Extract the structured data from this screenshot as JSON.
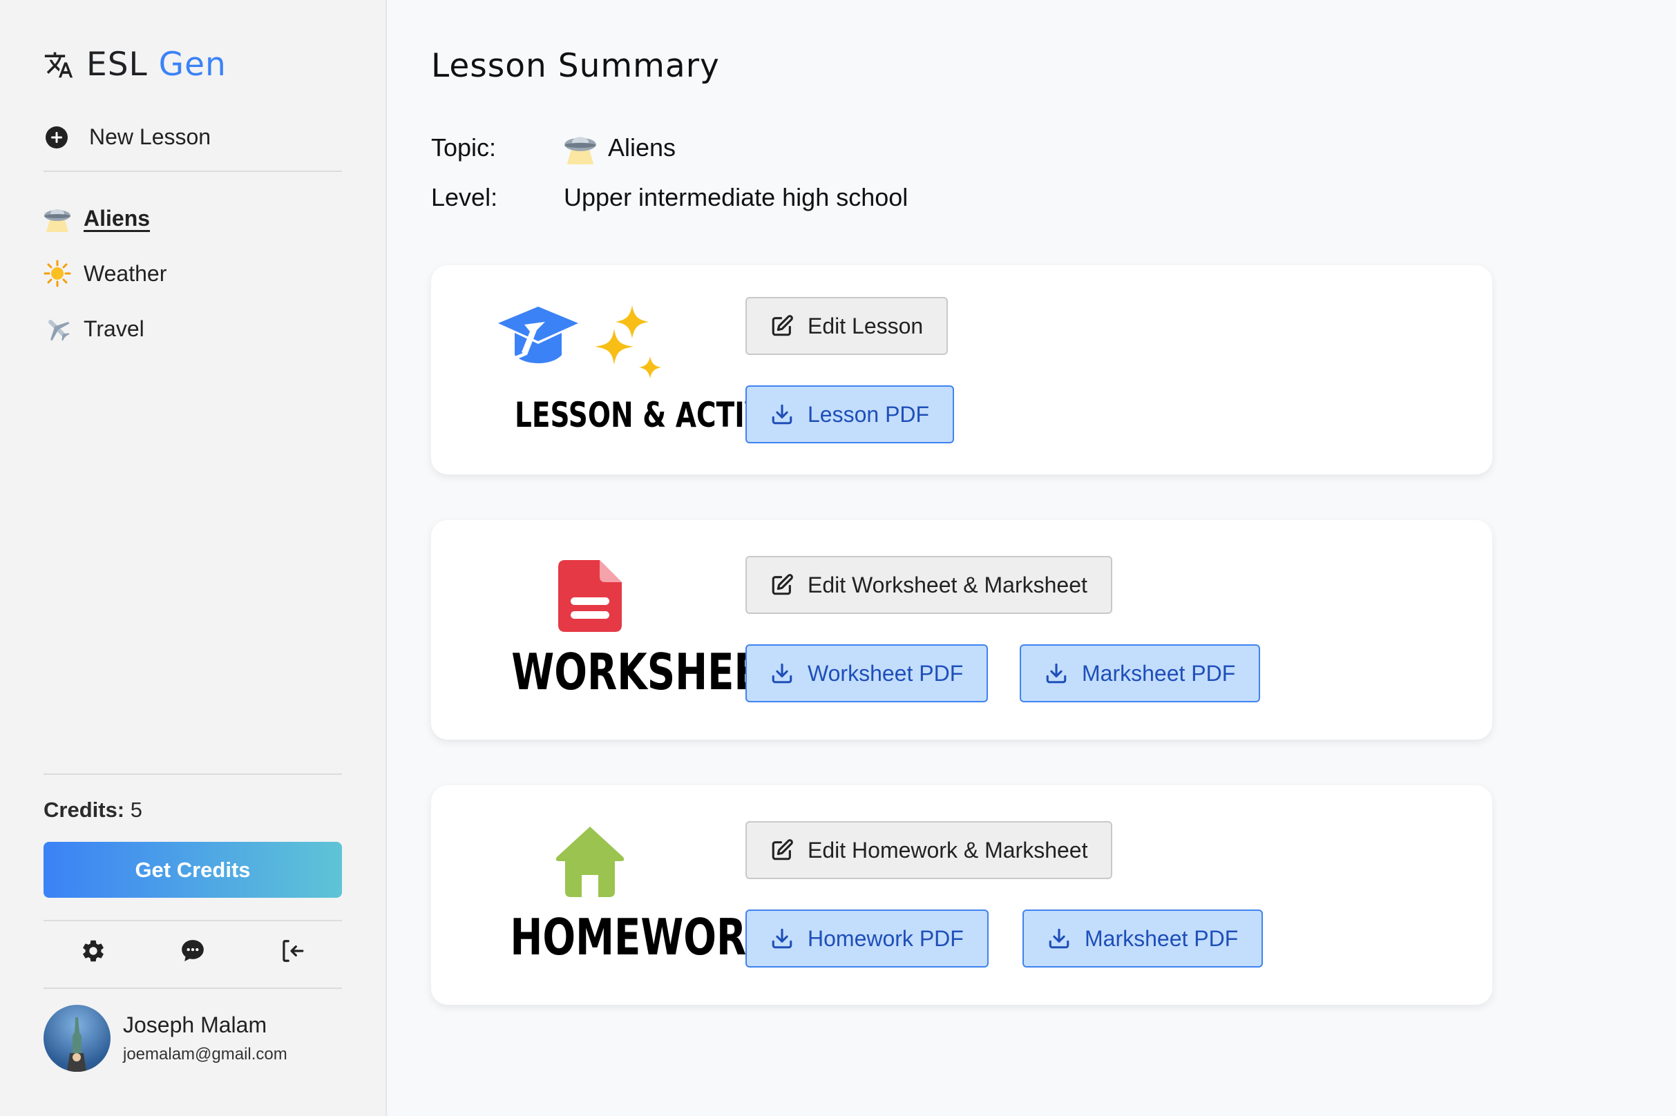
{
  "app": {
    "brand_main": "ESL",
    "brand_accent": "Gen"
  },
  "sidebar": {
    "new_lesson_label": "New Lesson",
    "lessons": [
      {
        "label": "Aliens",
        "icon": "ufo-icon",
        "active": true
      },
      {
        "label": "Weather",
        "icon": "sun-icon",
        "active": false
      },
      {
        "label": "Travel",
        "icon": "airplane-icon",
        "active": false
      }
    ],
    "credits_label": "Credits:",
    "credits_value": "5",
    "get_credits_label": "Get Credits",
    "footer_icons": [
      "settings-icon",
      "chat-icon",
      "logout-icon"
    ],
    "user": {
      "name": "Joseph Malam",
      "email": "joemalam@gmail.com"
    }
  },
  "main": {
    "title": "Lesson Summary",
    "topic_label": "Topic:",
    "topic_value": "Aliens",
    "level_label": "Level:",
    "level_value": "Upper intermediate high school",
    "cards": [
      {
        "heading": "LESSON & ACTIVITY",
        "edit_label": "Edit Lesson",
        "pdf_buttons": [
          "Lesson PDF"
        ]
      },
      {
        "heading": "WORKSHEET",
        "edit_label": "Edit Worksheet & Marksheet",
        "pdf_buttons": [
          "Worksheet PDF",
          "Marksheet PDF"
        ]
      },
      {
        "heading": "HOMEWORK",
        "edit_label": "Edit Homework & Marksheet",
        "pdf_buttons": [
          "Homework PDF",
          "Marksheet PDF"
        ]
      }
    ]
  },
  "colors": {
    "accent": "#3b82f6",
    "pdf_button_bg": "#c3ddfc",
    "pdf_button_text": "#1e4fb8",
    "worksheet_icon": "#e53945",
    "homework_icon": "#9bc34f",
    "sparkle": "#f8be16"
  }
}
